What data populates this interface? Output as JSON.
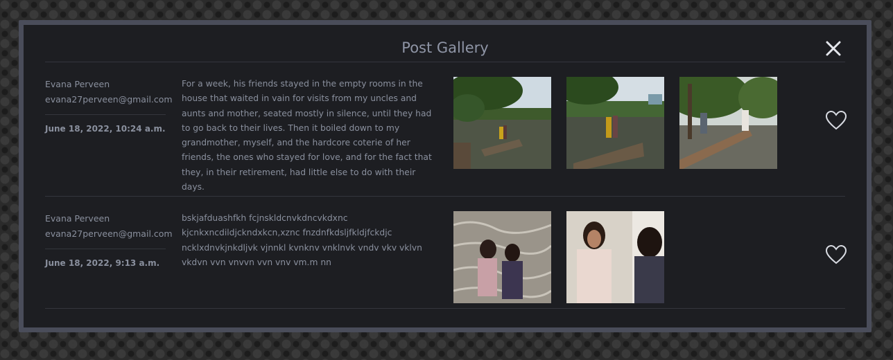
{
  "modal": {
    "title": "Post Gallery",
    "close_icon": "close-icon"
  },
  "posts": [
    {
      "author_name": "Evana Perveen",
      "author_email": "evana27perveen@gmail.com",
      "date": "June 18, 2022, 10:24 a.m.",
      "body": "For a week, his friends stayed in the empty rooms in the house that waited in vain for visits from my uncles and aunts and mother, seated mostly in silence, until they had to go back to their lives. Then it boiled down to my grandmother, myself, and the hardcore coterie of her friends, the ones who stayed for love, and for the fact that they, in their retirement, had little else to do with their days.",
      "photos": [
        "lake-photo",
        "lake-photo",
        "park-photo"
      ],
      "like_icon": "heart-icon"
    },
    {
      "author_name": "Evana Perveen",
      "author_email": "evana27perveen@gmail.com",
      "date": "June 18, 2022, 9:13 a.m.",
      "body": "bskjafduashfkh fcjnskldcnvkdncvkdxnc kjcnkxncdildjckndxkcn,xznc fnzdnfkdsljfkldjfckdjc ncklxdnvkjnkdljvk vjnnkl kvnknv vnklnvk vndv vkv vklvn vkdvn vvn vnvvn vvn vnv vm.m nn",
      "photos": [
        "portrait-photo",
        "portrait-photo"
      ],
      "like_icon": "heart-icon"
    }
  ]
}
